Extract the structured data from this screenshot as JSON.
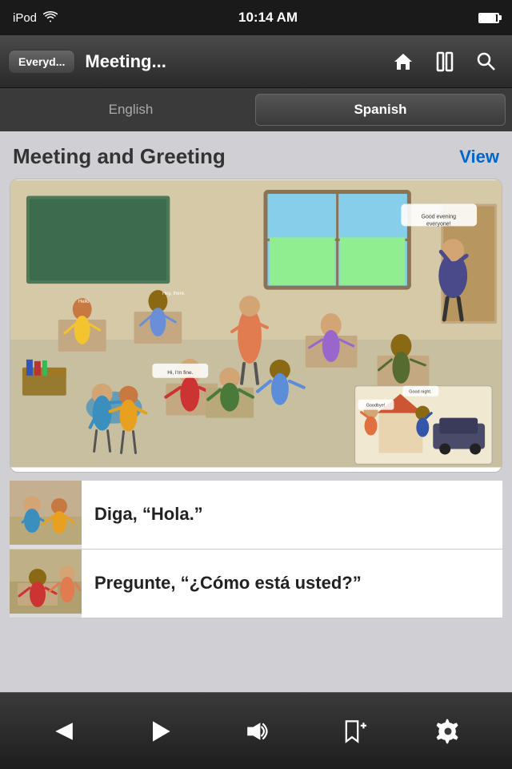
{
  "status_bar": {
    "device": "iPod",
    "time": "10:14 AM",
    "wifi": true,
    "battery": "full"
  },
  "nav_bar": {
    "back_label": "Everyd...",
    "title": "Meeting...",
    "home_icon": "home-icon",
    "bookmark_icon": "bookmark-icon",
    "search_icon": "search-icon"
  },
  "segment": {
    "english_label": "English",
    "spanish_label": "Spanish",
    "active": "spanish"
  },
  "main": {
    "section_title": "Meeting and Greeting",
    "view_label": "View",
    "list_items": [
      {
        "text": "Diga, “Hola.”"
      },
      {
        "text": "Pregunte, “¿Cómo está usted?”"
      }
    ]
  },
  "bottom_bar": {
    "prev_label": "previous",
    "play_label": "play",
    "volume_label": "volume",
    "bookmark_add_label": "add bookmark",
    "settings_label": "settings"
  }
}
